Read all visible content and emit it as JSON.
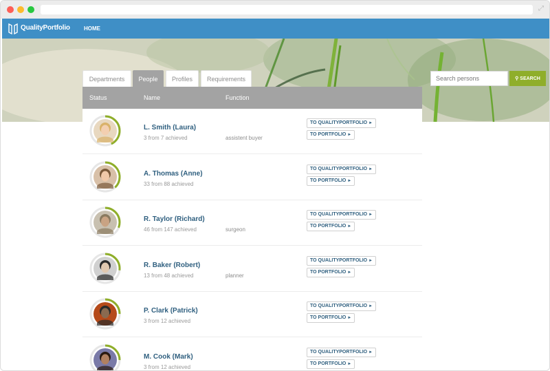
{
  "app": {
    "logo_text": "QualityPortfolio",
    "nav_home": "HOME"
  },
  "tabs": [
    {
      "label": "Departments",
      "active": false
    },
    {
      "label": "People",
      "active": true
    },
    {
      "label": "Profiles",
      "active": false
    },
    {
      "label": "Requirements",
      "active": false
    }
  ],
  "search": {
    "placeholder": "Search persons",
    "button_label": "SEARCH"
  },
  "table": {
    "headers": {
      "status": "Status",
      "name": "Name",
      "function": "Function"
    },
    "button_labels": {
      "qualityportfolio": "TO QUALITYPORTFOLIO",
      "portfolio": "TO PORTFOLIO"
    },
    "rows": [
      {
        "name": "L. Smith (Laura)",
        "achieved": "3 from 7 achieved",
        "function": "assistent buyer",
        "progress": 0.43
      },
      {
        "name": "A. Thomas (Anne)",
        "achieved": "33 from 88 achieved",
        "function": "",
        "progress": 0.38
      },
      {
        "name": "R. Taylor (Richard)",
        "achieved": "46 from 147 achieved",
        "function": "surgeon",
        "progress": 0.31
      },
      {
        "name": "R. Baker (Robert)",
        "achieved": "13 from 48 achieved",
        "function": "planner",
        "progress": 0.27
      },
      {
        "name": "P. Clark (Patrick)",
        "achieved": "3 from 12 achieved",
        "function": "",
        "progress": 0.25
      },
      {
        "name": "M. Cook (Mark)",
        "achieved": "3 from 12 achieved",
        "function": "",
        "progress": 0.25
      }
    ]
  },
  "colors": {
    "brand_blue": "#3f8fc6",
    "accent_green": "#8fae2a",
    "header_gray": "#a3a3a3",
    "name_blue": "#2f5f7f"
  }
}
